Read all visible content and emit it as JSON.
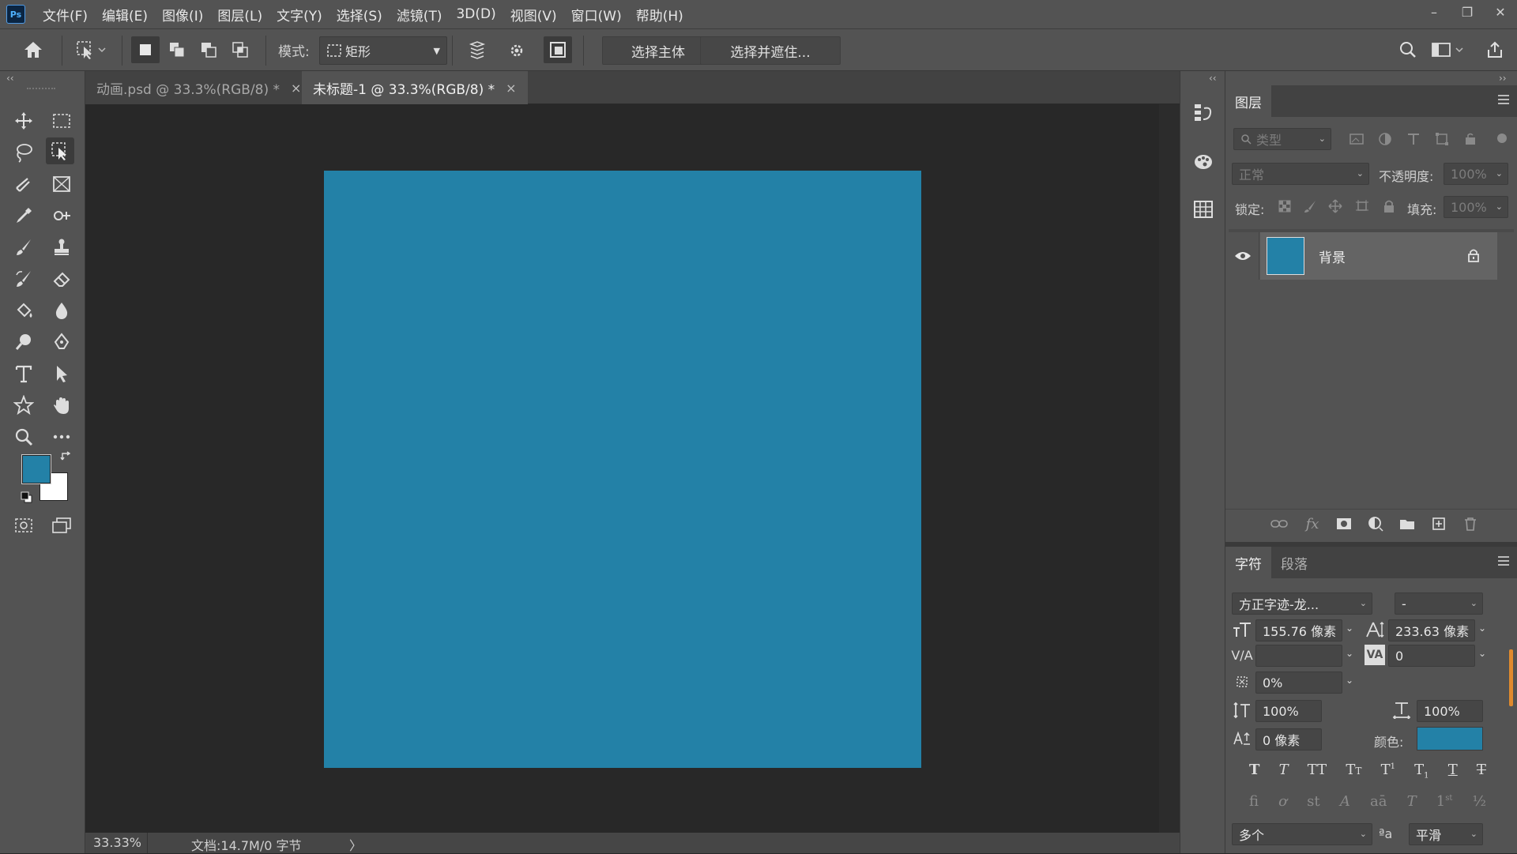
{
  "app": {
    "logo_text": "Ps"
  },
  "menu": [
    "文件(F)",
    "编辑(E)",
    "图像(I)",
    "图层(L)",
    "文字(Y)",
    "选择(S)",
    "滤镜(T)",
    "3D(D)",
    "视图(V)",
    "窗口(W)",
    "帮助(H)"
  ],
  "window_controls": {
    "minimize": "–",
    "restore": "❐",
    "close": "✕"
  },
  "options_bar": {
    "mode_label": "模式:",
    "mode_value": "矩形",
    "select_subject": "选择主体",
    "select_mask": "选择并遮住..."
  },
  "tabs": [
    {
      "label": "动画.psd @ 33.3%(RGB/8) *",
      "close": "×"
    },
    {
      "label": "未标题-1 @ 33.3%(RGB/8) *",
      "close": "×"
    }
  ],
  "status": {
    "zoom": "33.33%",
    "doc": "文档:14.7M/0 字节",
    "arrow": "〉"
  },
  "colors": {
    "foreground": "#2381a7",
    "background": "#ffffff",
    "canvas": "#2381a7"
  },
  "layers_panel": {
    "tab": "图层",
    "filter_placeholder": "类型",
    "blend_mode": "正常",
    "opacity_label": "不透明度:",
    "opacity_value": "100%",
    "lock_label": "锁定:",
    "fill_label": "填充:",
    "fill_value": "100%",
    "layers": [
      {
        "name": "背景",
        "color": "#2381a7",
        "locked": true
      }
    ]
  },
  "character_panel": {
    "tab_character": "字符",
    "tab_paragraph": "段落",
    "font_family": "方正字迹-龙...",
    "font_style": "-",
    "font_size": "155.76 像素",
    "leading": "233.63 像素",
    "kerning": "",
    "tracking": "0",
    "tsume": "0%",
    "vertical_scale": "100%",
    "horizontal_scale": "100%",
    "baseline_shift": "0 像素",
    "color_label": "颜色:",
    "color_value": "#2381a7",
    "language": "多个",
    "aa_label": "ªa",
    "antialias": "平滑"
  }
}
